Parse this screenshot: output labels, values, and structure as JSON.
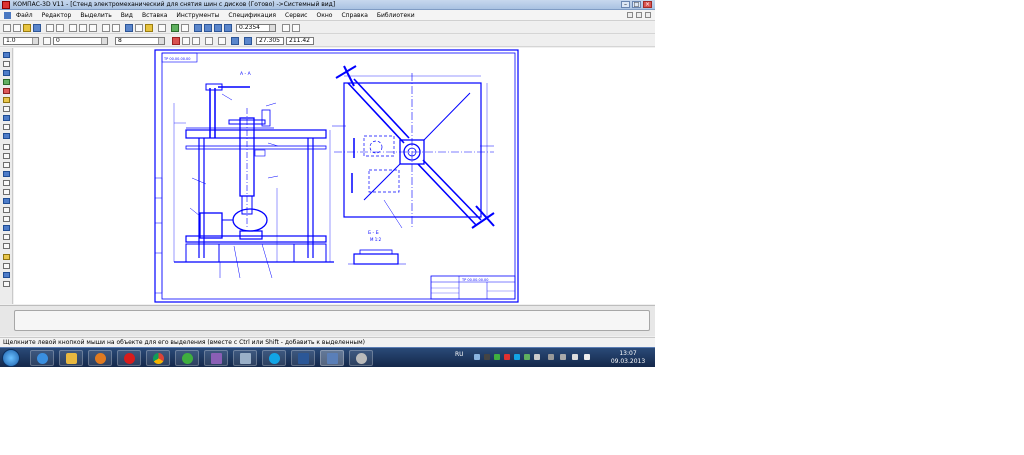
{
  "window": {
    "title": "КОМПАС-3D V11 - [Стенд электромеханический для снятия шин с дисков (Готово) ->Системный вид]",
    "controls": [
      "minimize-icon",
      "maximize-icon",
      "close-icon"
    ]
  },
  "menu": {
    "items": [
      "Файл",
      "Редактор",
      "Выделить",
      "Вид",
      "Вставка",
      "Инструменты",
      "Спецификация",
      "Сервис",
      "Окно",
      "Справка",
      "Библиотеки"
    ]
  },
  "toolbar": {
    "scale_value": "0.2354",
    "line_width_value": "1.0",
    "layer_value": "0",
    "style_value": "8",
    "cursor_x": "27.305",
    "cursor_y": "211.42"
  },
  "drawing": {
    "section_label": "А - А",
    "view_label_top": "Б - Б",
    "view_label_bottom": "М 1:2",
    "stamp_code": "ТР 00.00.00.00",
    "title_stamp_code": "ТР 00.00.00.00",
    "line_color": "#0000ff"
  },
  "status": {
    "message": "Щелкните левой кнопкой мыши на объекте для его выделения (вместе с Ctrl или Shift - добавить к выделенным)"
  },
  "taskbar": {
    "language": "RU",
    "time": "13:07",
    "date": "09.03.2013",
    "apps": [
      "ie-icon",
      "explorer-icon",
      "media-player-icon",
      "opera-icon",
      "chrome-icon",
      "icq-icon",
      "archive-icon",
      "media-icon",
      "skype-icon",
      "word-icon",
      "kompas-icon",
      "settings-icon"
    ]
  }
}
